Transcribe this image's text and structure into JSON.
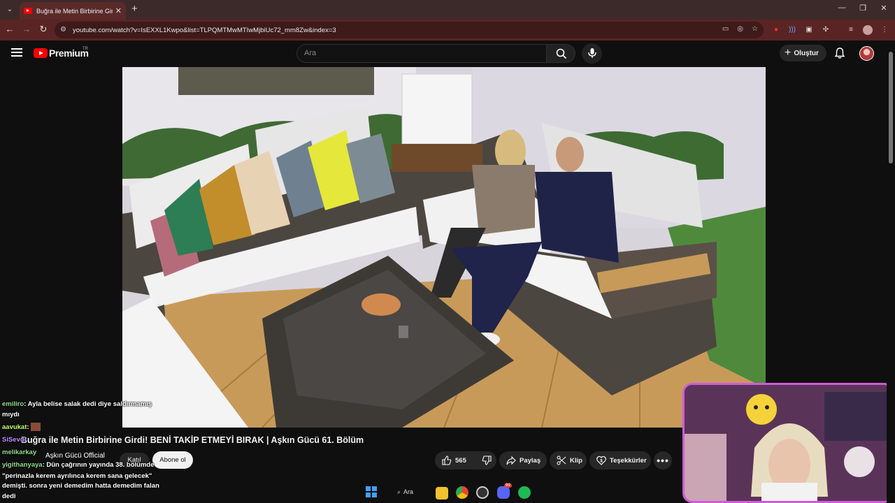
{
  "browser": {
    "tab_title": "Buğra ile Metin Birbirine Girdi! BENİ TAKİP ETMEYİ BIRAK",
    "url": "youtube.com/watch?v=IsEXXL1Kwpo&list=TLPQMTMwMTIwMjbiUc72_mm8Zw&index=3"
  },
  "header": {
    "logo_text": "Premium",
    "logo_region": "TR",
    "search_placeholder": "Ara",
    "create_label": "Oluştur"
  },
  "video": {
    "title": "Buğra ile Metin Birbirine Girdi! BENİ TAKİP ETMEYİ BIRAK | Aşkın Gücü 61. Bölüm",
    "channel": "Aşkın Gücü Official",
    "join_label": "Katıl",
    "subscribe_label": "Abone ol",
    "like_count": "565",
    "share_label": "Paylaş",
    "clip_label": "Klip",
    "thanks_label": "Teşekkürler"
  },
  "chat": {
    "messages": [
      {
        "user": "emiliro",
        "text": ": Ayla belise salak dedi diye saldırmamış"
      },
      {
        "user": "",
        "text": "mıydı"
      },
      {
        "user": "aavukat",
        "text": ":"
      },
      {
        "user": "SiSevdi",
        "text": "..."
      },
      {
        "user": "melikarkay",
        "text": ""
      },
      {
        "user": "yigithanyaya",
        "text": ": Dün çağrının yayında 38. bölümde"
      },
      {
        "user": "",
        "text": "\"perinazla kerem ayrılınca kerem sana gelecek\""
      },
      {
        "user": "",
        "text": "demişti. sonra yeni demedim hatta demedim falan"
      },
      {
        "user": "",
        "text": "dedi"
      }
    ]
  },
  "taskbar": {
    "search_label": "Ara",
    "discord_badge": "99"
  }
}
